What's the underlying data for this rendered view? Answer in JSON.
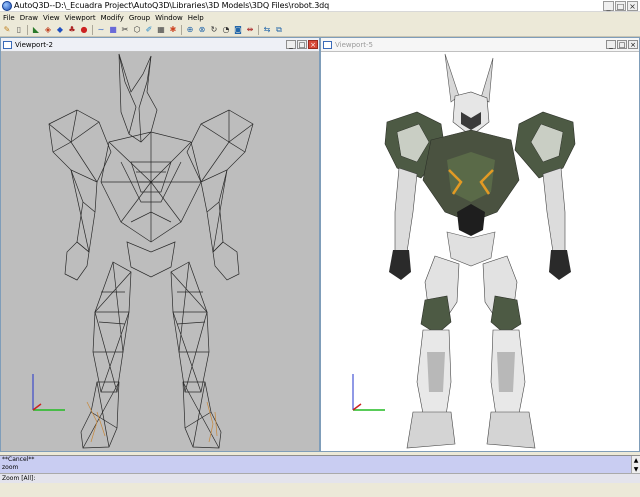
{
  "window": {
    "title": "AutoQ3D--D:\\_Ecuadra Project\\AutoQ3D\\Libraries\\3D Models\\3DQ Files\\robot.3dq",
    "minimize": "_",
    "maximize": "□",
    "close": "×"
  },
  "menu": [
    "File",
    "Draw",
    "View",
    "Viewport",
    "Modify",
    "Group",
    "Window",
    "Help"
  ],
  "toolbar_icons": [
    "pencil-icon",
    "new-file-icon",
    "open-icon",
    "save-icon",
    "material-icon",
    "palette-icon",
    "sphere-icon",
    "line-icon",
    "square-icon",
    "cut-icon",
    "polygon-icon",
    "edit-icon",
    "grid-icon",
    "render-icon",
    "zoom-icon",
    "pan-icon",
    "rotate-icon",
    "orbit-icon",
    "camera-icon",
    "measure-icon",
    "link-icon"
  ],
  "viewports": {
    "left": {
      "title": "Viewport-2",
      "mode": "wireframe"
    },
    "right": {
      "title": "Viewport-5",
      "mode": "textured"
    }
  },
  "command": {
    "line1": "**Cancel**",
    "line2": "zoom",
    "up": "▲",
    "down": "▼"
  },
  "status": {
    "text": "Zoom [All]:"
  },
  "colors": {
    "wire_bg": "#bdbdbd",
    "render_bg": "#ffffff",
    "command_bg": "#c9cdf2",
    "axis_x": "#22bb22",
    "axis_y": "#2233cc",
    "axis_z": "#cc2222"
  }
}
